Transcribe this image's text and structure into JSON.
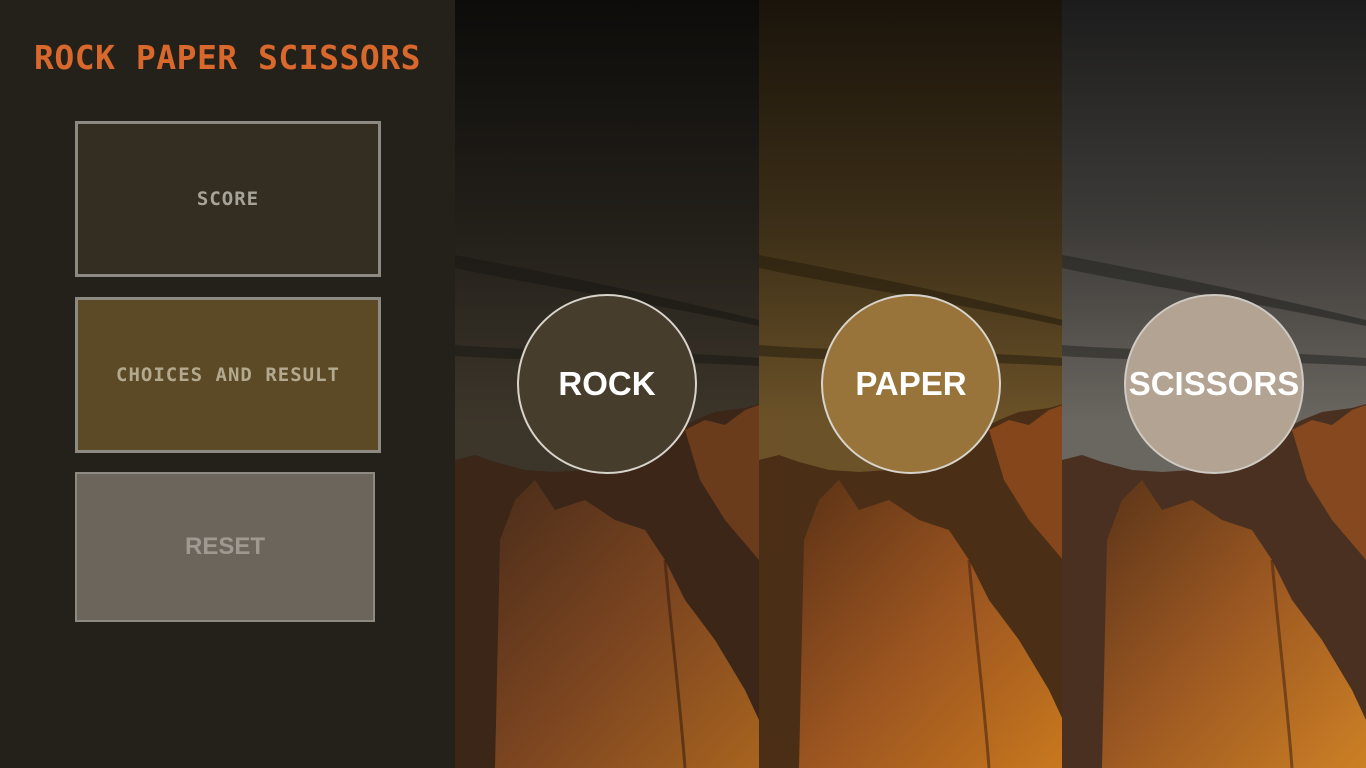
{
  "app": {
    "title": "ROCK PAPER SCISSORS"
  },
  "panel": {
    "score_label": "SCORE",
    "result_label": "CHOICES AND RESULT",
    "reset_label": "RESET"
  },
  "choices": [
    {
      "label": "ROCK"
    },
    {
      "label": "PAPER"
    },
    {
      "label": "SCISSORS"
    }
  ],
  "colors": {
    "title": "#d8682c",
    "panel_background": "#24211a",
    "score_box": "#342d21",
    "result_box": "#5c4a26",
    "reset_button": "#6b655b",
    "rock_button": "#463d2d",
    "paper_button": "#98743a",
    "scissors_button": "#b2a392"
  }
}
